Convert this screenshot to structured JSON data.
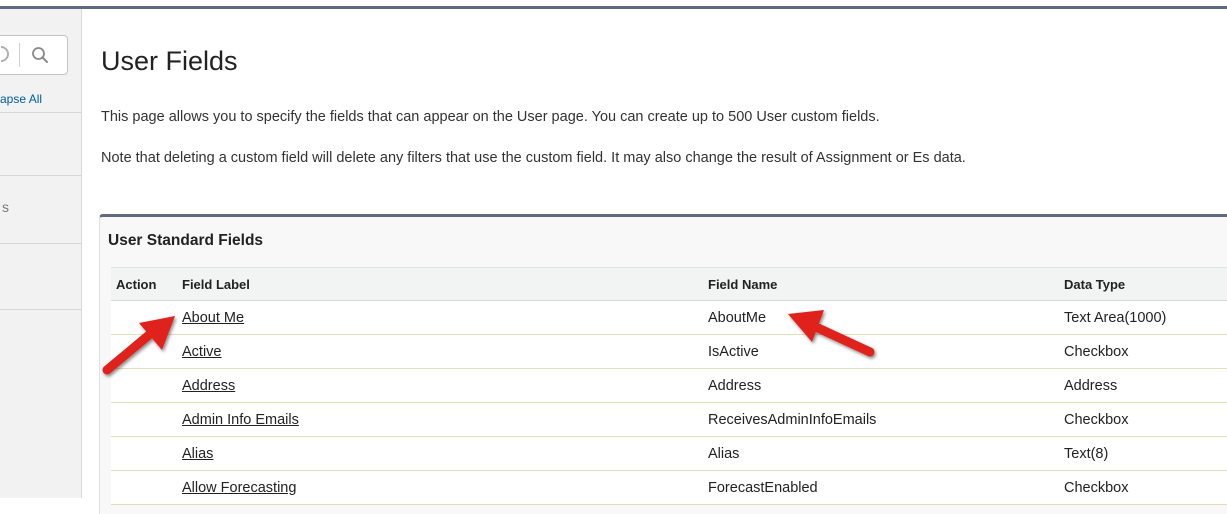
{
  "sidebar": {
    "collapse_all_label": "apse All",
    "partial_glyph": "s"
  },
  "page": {
    "title": "User Fields",
    "intro": "This page allows you to specify the fields that can appear on the User page. You can create up to 500 User custom fields.",
    "note": "Note that deleting a custom field will delete any filters that use the custom field. It may also change the result of Assignment or Es data."
  },
  "standard_fields": {
    "title": "User Standard Fields",
    "columns": {
      "action": "Action",
      "field_label": "Field Label",
      "field_name": "Field Name",
      "data_type": "Data Type"
    },
    "rows": [
      {
        "label": "About Me",
        "name": "AboutMe",
        "type": "Text Area(1000)"
      },
      {
        "label": "Active",
        "name": "IsActive",
        "type": "Checkbox"
      },
      {
        "label": "Address",
        "name": "Address",
        "type": "Address"
      },
      {
        "label": "Admin Info Emails",
        "name": "ReceivesAdminInfoEmails",
        "type": "Checkbox"
      },
      {
        "label": "Alias",
        "name": "Alias",
        "type": "Text(8)"
      },
      {
        "label": "Allow Forecasting",
        "name": "ForecastEnabled",
        "type": "Checkbox"
      }
    ]
  },
  "colors": {
    "accent_bar": "#5e6a7d",
    "annotation_arrow": "#e0221a",
    "sidebar_link": "#015ba7"
  },
  "icons": {
    "search": "search-icon",
    "annotation": "red-arrow-icon"
  }
}
